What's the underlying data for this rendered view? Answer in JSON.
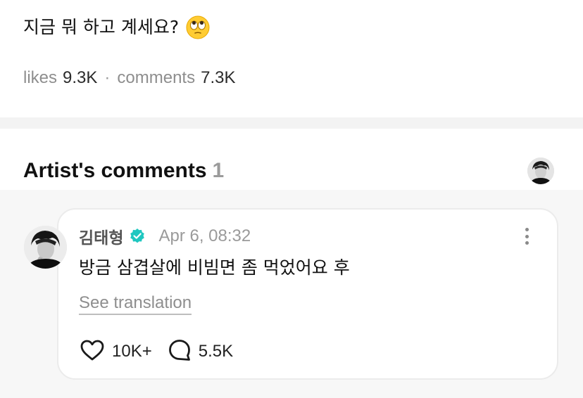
{
  "post": {
    "text": "지금 뭐 하고 계세요?",
    "emoji": "eye-roll-face-emoji"
  },
  "stats": {
    "likes_label": "likes",
    "likes_value": "9.3K",
    "separator": "·",
    "comments_label": "comments",
    "comments_value": "7.3K"
  },
  "artist_comments": {
    "title": "Artist's comments",
    "count": "1"
  },
  "comment": {
    "author": "김태형",
    "verified": true,
    "timestamp": "Apr 6, 08:32",
    "body": "방금 삼겹살에 비빔면 좀 먹었어요 후",
    "see_translation": "See translation",
    "likes": "10K+",
    "replies": "5.5K"
  },
  "colors": {
    "verified_badge": "#1fc7c0",
    "divider": "#f3f3f3",
    "comment_area_bg": "#f7f7f7"
  }
}
